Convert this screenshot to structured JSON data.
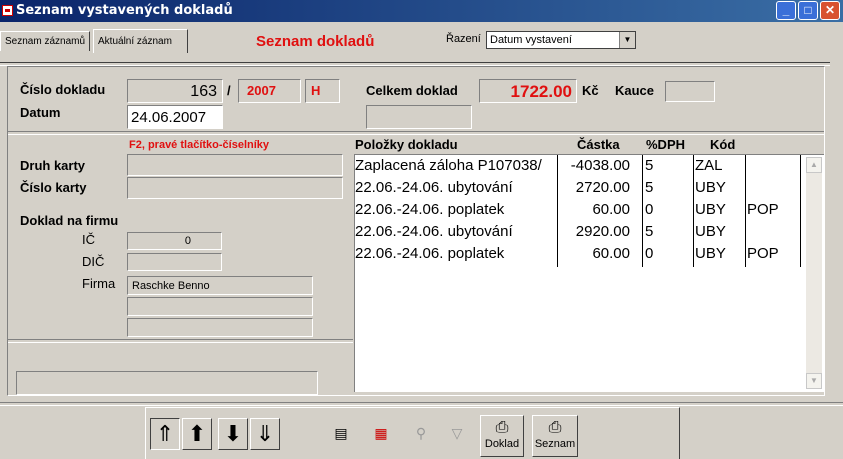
{
  "window": {
    "title": "Seznam vystavených dokladů",
    "buttons": {
      "minimize": "_",
      "maximize": "□",
      "close": "✕"
    }
  },
  "tabs": [
    {
      "label": "Seznam záznamů"
    },
    {
      "label": "Aktuální záznam"
    }
  ],
  "heading": "Seznam dokladů",
  "sort": {
    "label": "Řazení",
    "value": "Datum vystavení"
  },
  "document": {
    "number_label": "Číslo dokladu",
    "number": "163",
    "separator": "/",
    "year": "2007",
    "flag": "H",
    "date_label": "Datum",
    "date": "24.06.2007",
    "total_label": "Celkem doklad",
    "total": "1722.00",
    "currency": "Kč",
    "deposit_label": "Kauce",
    "deposit": ""
  },
  "hint": "F2, pravé tlačítko-číselníky",
  "card": {
    "type_label": "Druh karty",
    "type": "",
    "number_label": "Číslo karty",
    "number": ""
  },
  "company": {
    "section_label": "Doklad na firmu",
    "ic_label": "IČ",
    "ic": "0",
    "dic_label": "DIČ",
    "dic": "",
    "name_label": "Firma",
    "name": "Raschke Benno",
    "line2": "",
    "line3": ""
  },
  "note": "",
  "items": {
    "columns": [
      "Položky dokladu",
      "Částka",
      "%DPH",
      "Kód"
    ],
    "rows": [
      {
        "desc": "Zaplacená záloha P107038/",
        "amount": "-4038.00",
        "vat": "5",
        "code": "ZAL",
        "code2": ""
      },
      {
        "desc": "22.06.-24.06. ubytování",
        "amount": "2720.00",
        "vat": "5",
        "code": "UBY",
        "code2": ""
      },
      {
        "desc": "22.06.-24.06. poplatek",
        "amount": "60.00",
        "vat": "0",
        "code": "UBY",
        "code2": "POP"
      },
      {
        "desc": "22.06.-24.06. ubytování",
        "amount": "2920.00",
        "vat": "5",
        "code": "UBY",
        "code2": ""
      },
      {
        "desc": "22.06.-24.06. poplatek",
        "amount": "60.00",
        "vat": "0",
        "code": "UBY",
        "code2": "POP"
      }
    ]
  },
  "toolbar": {
    "doklad_label": "Doklad",
    "seznam_label": "Seznam",
    "icons": [
      "first-record-icon",
      "previous-record-icon",
      "next-record-icon",
      "last-record-icon",
      "edit-icon",
      "delete-icon",
      "binoculars-icon",
      "filter-icon",
      "printer-icon",
      "printer-icon"
    ]
  },
  "colors": {
    "accent_red": "#e01010",
    "title_bar": "#0a246a",
    "face": "#d4d0c8"
  }
}
